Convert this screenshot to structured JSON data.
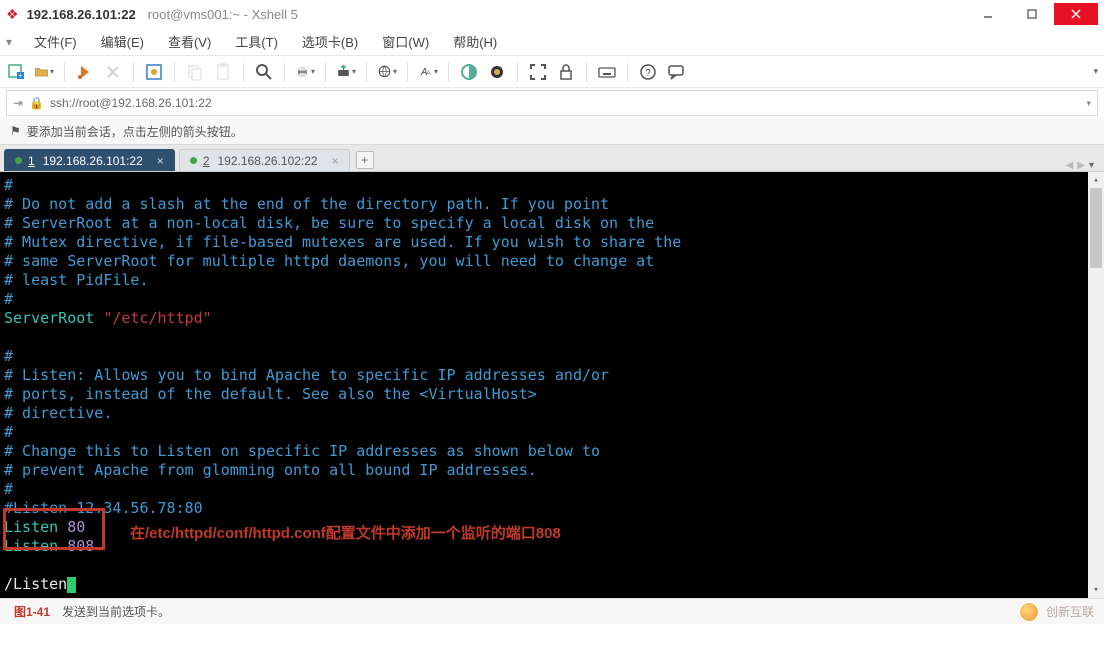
{
  "titlebar": {
    "address": "192.168.26.101:22",
    "context": "root@vms001:~ - Xshell 5"
  },
  "menu": {
    "file": "文件(F)",
    "edit": "编辑(E)",
    "view": "查看(V)",
    "tools": "工具(T)",
    "tabs": "选项卡(B)",
    "window": "窗口(W)",
    "help": "帮助(H)"
  },
  "addressbar": {
    "url": "ssh://root@192.168.26.101:22"
  },
  "hint": "要添加当前会话，点击左侧的箭头按钮。",
  "tabs": [
    {
      "index": "1",
      "label": "192.168.26.101:22",
      "active": true
    },
    {
      "index": "2",
      "label": "192.168.26.102:22",
      "active": false
    }
  ],
  "terminal": {
    "lines": [
      {
        "cls": "c-comment",
        "text": "#"
      },
      {
        "cls": "c-comment",
        "text": "# Do not add a slash at the end of the directory path.  If you point"
      },
      {
        "cls": "c-comment",
        "text": "# ServerRoot at a non-local disk, be sure to specify a local disk on the"
      },
      {
        "cls": "c-comment",
        "text": "# Mutex directive, if file-based mutexes are used.  If you wish to share the"
      },
      {
        "cls": "c-comment",
        "text": "# same ServerRoot for multiple httpd daemons, you will need to change at"
      },
      {
        "cls": "c-comment",
        "text": "# least PidFile."
      },
      {
        "cls": "c-comment",
        "text": "#"
      }
    ],
    "serverroot_kw": "ServerRoot",
    "serverroot_val": "\"/etc/httpd\"",
    "lines2": [
      {
        "cls": "c-comment",
        "text": "#"
      },
      {
        "cls": "c-comment",
        "text": "# Listen: Allows you to bind Apache to specific IP addresses and/or"
      },
      {
        "cls": "c-comment",
        "text": "# ports, instead of the default. See also the <VirtualHost>"
      },
      {
        "cls": "c-comment",
        "text": "# directive."
      },
      {
        "cls": "c-comment",
        "text": "#"
      },
      {
        "cls": "c-comment",
        "text": "# Change this to Listen on specific IP addresses as shown below to"
      },
      {
        "cls": "c-comment",
        "text": "# prevent Apache from glomming onto all bound IP addresses."
      },
      {
        "cls": "c-comment",
        "text": "#"
      },
      {
        "cls": "c-comment",
        "text": "#Listen 12.34.56.78:80"
      }
    ],
    "listen": [
      {
        "kw": "Listen",
        "port": "80"
      },
      {
        "kw": "Listen",
        "port": "808"
      }
    ],
    "search": "/Listen",
    "annotation": "在/etc/httpd/conf/httpd.conf配置文件中添加一个监听的端口808"
  },
  "statusbar": {
    "figure": "图1-41",
    "text": "发送到当前选项卡。",
    "brand": "创新互联"
  }
}
